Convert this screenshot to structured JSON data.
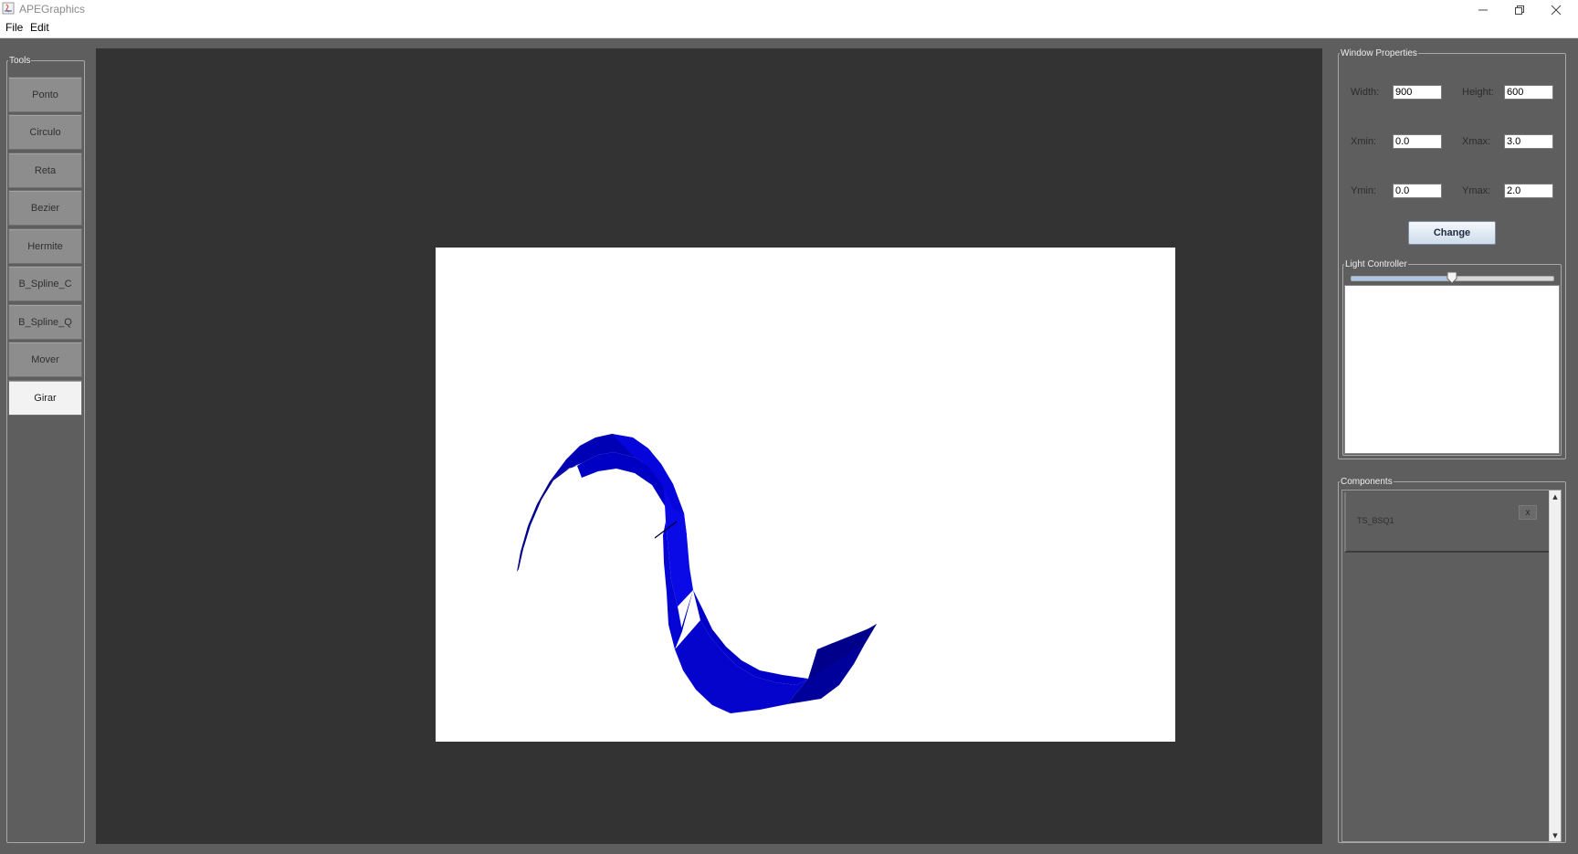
{
  "window": {
    "title": "APEGraphics",
    "controls": [
      "minimize-icon",
      "restore-icon",
      "close-icon"
    ]
  },
  "menu": {
    "items": [
      {
        "label": "File"
      },
      {
        "label": "Edit"
      }
    ]
  },
  "tools": {
    "legend": "Tools",
    "items": [
      {
        "label": "Ponto",
        "active": false
      },
      {
        "label": "Circulo",
        "active": false
      },
      {
        "label": "Reta",
        "active": false
      },
      {
        "label": "Bezier",
        "active": false
      },
      {
        "label": "Hermite",
        "active": false
      },
      {
        "label": "B_Spline_C",
        "active": false
      },
      {
        "label": "B_Spline_Q",
        "active": false
      },
      {
        "label": "Mover",
        "active": false
      },
      {
        "label": "Girar",
        "active": true
      }
    ]
  },
  "window_properties": {
    "legend": "Window Properties",
    "width_label": "Width:",
    "width_value": "900",
    "height_label": "Height:",
    "height_value": "600",
    "xmin_label": "Xmin:",
    "xmin_value": "0.0",
    "xmax_label": "Xmax:",
    "xmax_value": "3.0",
    "ymin_label": "Ymin:",
    "ymin_value": "0.0",
    "ymax_label": "Ymax:",
    "ymax_value": "2.0",
    "change_label": "Change"
  },
  "light_controller": {
    "legend": "Light Controller",
    "slider_value": 0.5
  },
  "components": {
    "legend": "Components",
    "items": [
      {
        "name": "TS_BSQ1",
        "remove_label": "x"
      }
    ]
  },
  "colors": {
    "surface_dark": "#00008a",
    "surface_mid": "#0000c8",
    "surface_light": "#0a0ae6"
  }
}
